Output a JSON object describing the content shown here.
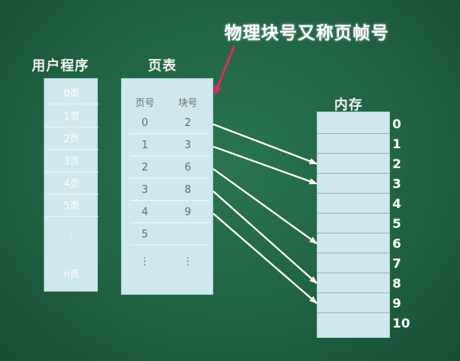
{
  "annotation": "物理块号又称页帧号",
  "user_program": {
    "title": "用户程序",
    "cells": [
      "0页",
      "1页",
      "2页",
      "3页",
      "4页",
      "5页",
      "⋮",
      "n页"
    ]
  },
  "page_table": {
    "title": "页表",
    "col_page": "页号",
    "col_block": "块号",
    "rows": [
      {
        "page": "0",
        "block": "2"
      },
      {
        "page": "1",
        "block": "3"
      },
      {
        "page": "2",
        "block": "6"
      },
      {
        "page": "3",
        "block": "8"
      },
      {
        "page": "4",
        "block": "9"
      },
      {
        "page": "5",
        "block": ""
      },
      {
        "page": "⋮",
        "block": "⋮"
      }
    ]
  },
  "memory": {
    "title": "内存",
    "slots": [
      "0",
      "1",
      "2",
      "3",
      "4",
      "5",
      "6",
      "7",
      "8",
      "9",
      "10"
    ]
  },
  "mappings": [
    {
      "page": 0,
      "block": 2
    },
    {
      "page": 1,
      "block": 3
    },
    {
      "page": 2,
      "block": 6
    },
    {
      "page": 3,
      "block": 8
    },
    {
      "page": 4,
      "block": 9
    }
  ],
  "colors": {
    "arrow": "#ffffff",
    "pointer": "#e0286a",
    "box": "#cfe8ee"
  }
}
